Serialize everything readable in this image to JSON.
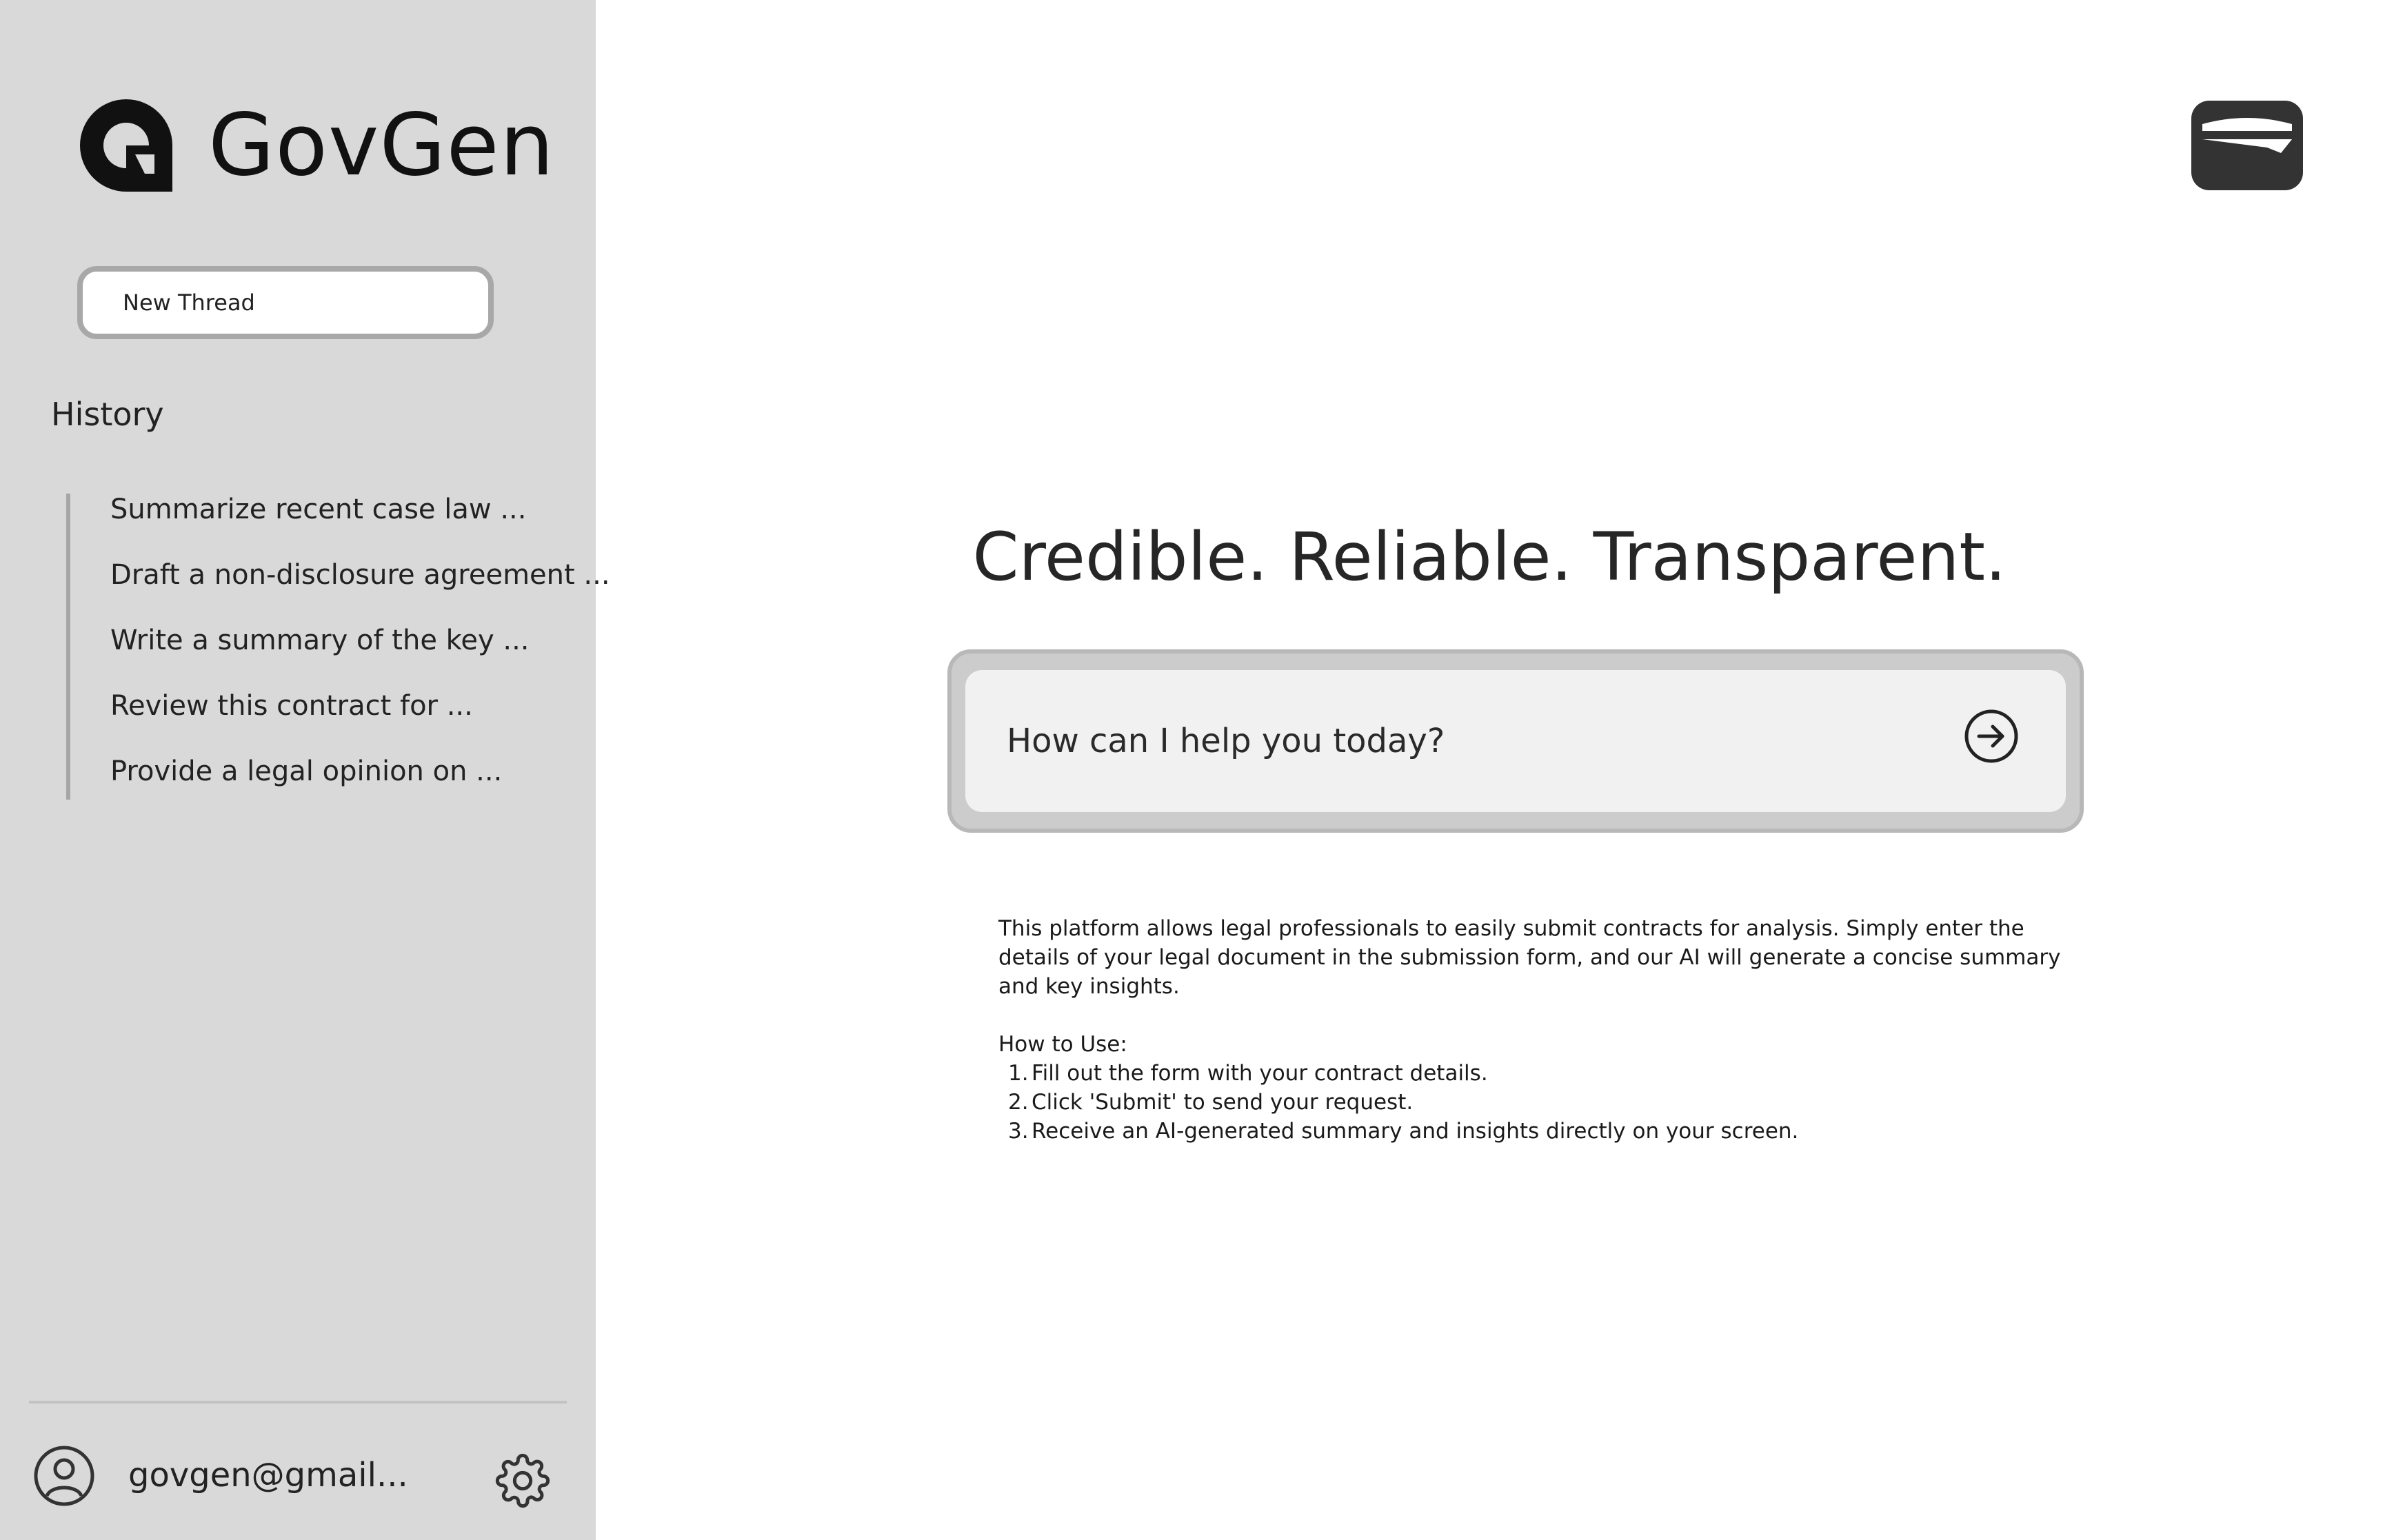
{
  "sidebar": {
    "brand_name": "GovGen",
    "logo_icon": "govgen-logo-icon",
    "new_thread_label": "New Thread",
    "history_title": "History",
    "history_items": [
      "Summarize recent case law ...",
      "Draft a non-disclosure agreement ...",
      "Write a summary of the key ...",
      "Review this contract for ...",
      "Provide a legal opinion on ..."
    ],
    "user_email": "govgen@gmail...",
    "user_icon": "user-avatar-icon",
    "settings_icon": "gear-icon"
  },
  "header": {
    "top_right_icon": "wallet-icon"
  },
  "main": {
    "headline": "Credible. Reliable. Transparent.",
    "prompt_placeholder": "How can I help you today?",
    "send_icon": "arrow-right-circle-icon",
    "description": "This platform allows legal professionals to easily submit contracts for analysis. Simply enter the details of your legal document in the submission form, and our AI will generate a concise summary and key insights.",
    "how_to_title": "How to Use:",
    "steps": [
      {
        "num": "1.",
        "text": "Fill out the form with your contract details."
      },
      {
        "num": "2.",
        "text": "Click 'Submit' to send your request."
      },
      {
        "num": "3.",
        "text": "Receive an AI-generated summary and insights directly on your screen."
      }
    ]
  },
  "colors": {
    "sidebar_bg": "#d9d9d9",
    "main_bg": "#ffffff",
    "prompt_frame": "#cccccc",
    "prompt_field": "#f1f1f1",
    "icon_dark": "#333333"
  }
}
